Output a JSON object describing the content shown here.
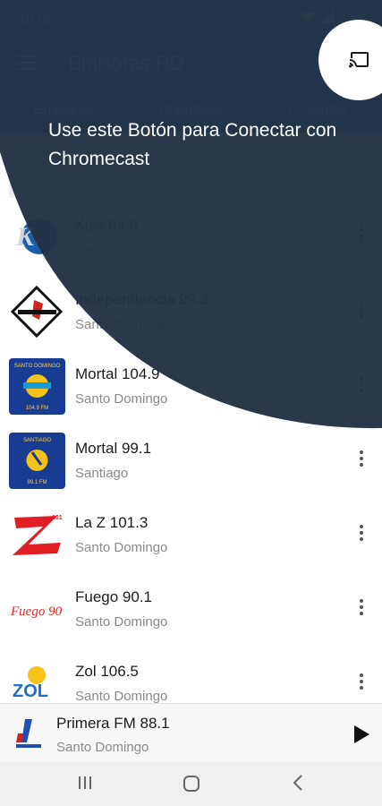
{
  "status_bar": {
    "time": "10:05",
    "battery": "33%"
  },
  "app_bar": {
    "title": "Emisoras RD"
  },
  "tabs": [
    {
      "label": "Emisoras"
    },
    {
      "label": "Populares"
    },
    {
      "label": "Favoritos"
    }
  ],
  "stations": [
    {
      "name": "Kiss 94.9",
      "city": "Santo Domingo"
    },
    {
      "name": "Independencia 99.3",
      "city": "Santo Domingo"
    },
    {
      "name": "Mortal 104.9",
      "city": "Santo Domingo"
    },
    {
      "name": "Mortal 99.1",
      "city": "Santiago"
    },
    {
      "name": "La Z 101.3",
      "city": "Santo Domingo"
    },
    {
      "name": "Fuego 90.1",
      "city": "Santo Domingo"
    },
    {
      "name": "Zol 106.5",
      "city": "Santo Domingo"
    }
  ],
  "logos": {
    "mortal_1049_header": "SANTO DOMINGO",
    "mortal_1049_freq": "104.9 FM",
    "mortal_991_header": "SANTIAGO",
    "mortal_991_freq": "99.1 FM",
    "laz_number": "101",
    "fuego_text": "Fuego 90",
    "zol_text": "ZOL"
  },
  "now_playing": {
    "name": "Primera FM 88.1",
    "city": "Santo Domingo"
  },
  "tutorial": {
    "message": "Use este Botón para Conectar con Chromecast",
    "overlay_color": "#233244"
  },
  "colors": {
    "primary": "#2e6bd8",
    "overlay": "#233244",
    "text_secondary": "#8a8a8a"
  },
  "icons": {
    "menu": "menu-icon",
    "cast": "cast-icon",
    "more": "more-vert-icon",
    "play": "play-icon"
  }
}
